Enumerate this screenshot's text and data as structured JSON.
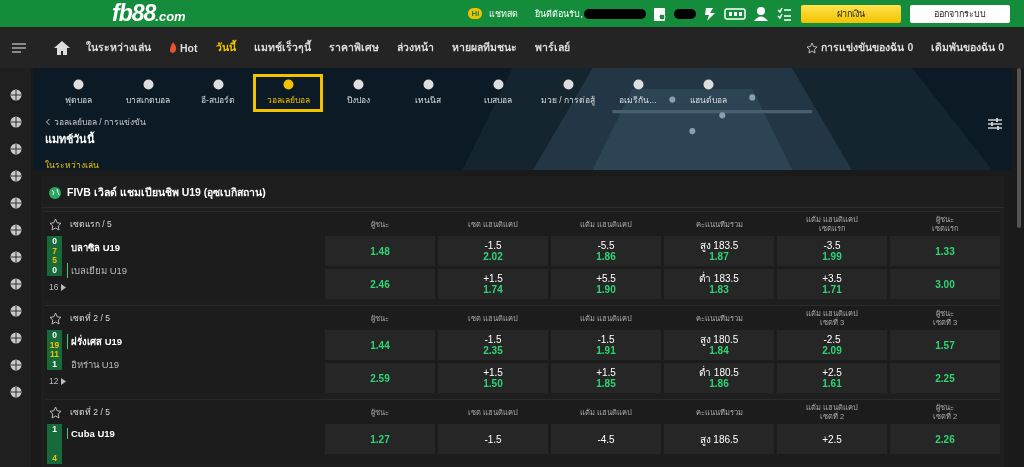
{
  "top_bar": {
    "logo": {
      "main": "fb88",
      "suffix": ".com"
    },
    "chat_badge": "Hi",
    "chat": "แชทสด",
    "welcome": "ยินดีต้อนรับ,",
    "buttons": [
      {
        "label": "ฝากเงิน",
        "kind": "primary"
      },
      {
        "label": "ออกจากระบบ",
        "kind": "secondary"
      }
    ]
  },
  "nav": {
    "items": [
      {
        "label": "ในระหว่างเล่น",
        "selected": false,
        "kind": "text"
      },
      {
        "label": "Hot",
        "selected": false,
        "kind": "hot"
      },
      {
        "label": "วันนี้",
        "selected": true,
        "kind": "text"
      },
      {
        "label": "แมทช์เร็วๆนี้",
        "selected": false,
        "kind": "text"
      },
      {
        "label": "ราคาพิเศษ",
        "selected": false,
        "kind": "text"
      },
      {
        "label": "ล่วงหน้า",
        "selected": false,
        "kind": "text"
      },
      {
        "label": "หายผลทีมชนะ",
        "selected": false,
        "kind": "text"
      },
      {
        "label": "พาร์เลย์",
        "selected": false,
        "kind": "text"
      }
    ],
    "right": [
      {
        "label": "การแข่งขันของฉัน 0",
        "kind": "star"
      },
      {
        "label": "เดิมพันของฉัน 0",
        "kind": "text"
      }
    ]
  },
  "sports": [
    {
      "label": "ฟุตบอล",
      "selected": false
    },
    {
      "label": "บาสเกตบอล",
      "selected": false
    },
    {
      "label": "อี-สปอร์ต",
      "selected": false
    },
    {
      "label": "วอลเลย์บอล",
      "selected": true
    },
    {
      "label": "ปิงปอง",
      "selected": false
    },
    {
      "label": "เทนนิส",
      "selected": false
    },
    {
      "label": "เบสบอล",
      "selected": false
    },
    {
      "label": "มวย / การต่อสู้",
      "selected": false
    },
    {
      "label": "อเมริกัน...",
      "selected": false
    },
    {
      "label": "แฮนด์บอล",
      "selected": false
    }
  ],
  "breadcrumb": "วอลเลย์บอล / การแข่งขัน",
  "page_title": "แมทช์วันนี้",
  "filter": "ในระหว่างเล่น",
  "league": "FIVB เวิลด์ แชมเปียนชิพ U19 (อุซเบกิสถาน)",
  "matches": [
    {
      "period": "เซตแรก / 5",
      "headers": [
        [
          "ผู้ชนะ"
        ],
        [
          "เซต แฮนดิแคป"
        ],
        [
          "แต้ม แฮนดิแคป"
        ],
        [
          "คะแนนทีมรวม"
        ],
        [
          "แต้ม แฮนดิแคป",
          "เซตแรก"
        ],
        [
          "ผู้ชนะ",
          "เซตแรก"
        ]
      ],
      "scores": [
        "0",
        "7",
        "5",
        "0"
      ],
      "teams": [
        {
          "name": "บลาซิล U19",
          "serving": false
        },
        {
          "name": "เบลเยียม U19",
          "serving": true
        }
      ],
      "more": "16",
      "rows": [
        [
          {
            "price": "1.48"
          },
          {
            "line": "-1.5",
            "price": "2.02"
          },
          {
            "line": "-5.5",
            "price": "1.86"
          },
          {
            "line": "สูง 183.5",
            "price": "1.87"
          },
          {
            "line": "-3.5",
            "price": "1.99"
          },
          {
            "price": "1.33"
          }
        ],
        [
          {
            "price": "2.46"
          },
          {
            "line": "+1.5",
            "price": "1.74"
          },
          {
            "line": "+5.5",
            "price": "1.90"
          },
          {
            "line": "ต่ำ 183.5",
            "price": "1.83"
          },
          {
            "line": "+3.5",
            "price": "1.71"
          },
          {
            "price": "3.00"
          }
        ]
      ]
    },
    {
      "period": "เซตที่ 2 / 5",
      "headers": [
        [
          "ผู้ชนะ"
        ],
        [
          "เซต แฮนดิแคป"
        ],
        [
          "แต้ม แฮนดิแคป"
        ],
        [
          "คะแนนทีมรวม"
        ],
        [
          "แต้ม แฮนดิแคป",
          "เซตที่ 3"
        ],
        [
          "ผู้ชนะ",
          "เซตที่ 3"
        ]
      ],
      "scores": [
        "0",
        "19",
        "11",
        "1"
      ],
      "teams": [
        {
          "name": "ฝรั่งเศส U19",
          "serving": true
        },
        {
          "name": "อิหร่าน U19",
          "serving": false
        }
      ],
      "more": "12",
      "rows": [
        [
          {
            "price": "1.44"
          },
          {
            "line": "-1.5",
            "price": "2.35"
          },
          {
            "line": "-1.5",
            "price": "1.91"
          },
          {
            "line": "สูง 180.5",
            "price": "1.84"
          },
          {
            "line": "-2.5",
            "price": "2.09"
          },
          {
            "price": "1.57"
          }
        ],
        [
          {
            "price": "2.59"
          },
          {
            "line": "+1.5",
            "price": "1.50"
          },
          {
            "line": "+1.5",
            "price": "1.85"
          },
          {
            "line": "ต่ำ 180.5",
            "price": "1.86"
          },
          {
            "line": "+2.5",
            "price": "1.61"
          },
          {
            "price": "2.25"
          }
        ]
      ]
    },
    {
      "period": "เซตที่ 2 / 5",
      "headers": [
        [
          "ผู้ชนะ"
        ],
        [
          "เซต แฮนดิแคป"
        ],
        [
          "แต้ม แฮนดิแคป"
        ],
        [
          "คะแนนทีมรวม"
        ],
        [
          "แต้ม แฮนดิแคป",
          "เซตที่ 2"
        ],
        [
          "ผู้ชนะ",
          "เซตที่ 2"
        ]
      ],
      "scores": [
        "1",
        "4"
      ],
      "teams": [
        {
          "name": "Cuba U19",
          "serving": true
        }
      ],
      "rows": [
        [
          {
            "price": "1.27"
          },
          {
            "line": "-1.5"
          },
          {
            "line": "-4.5"
          },
          {
            "line": "สูง 186.5"
          },
          {
            "line": "+2.5"
          },
          {
            "price": "2.26"
          }
        ]
      ]
    }
  ]
}
